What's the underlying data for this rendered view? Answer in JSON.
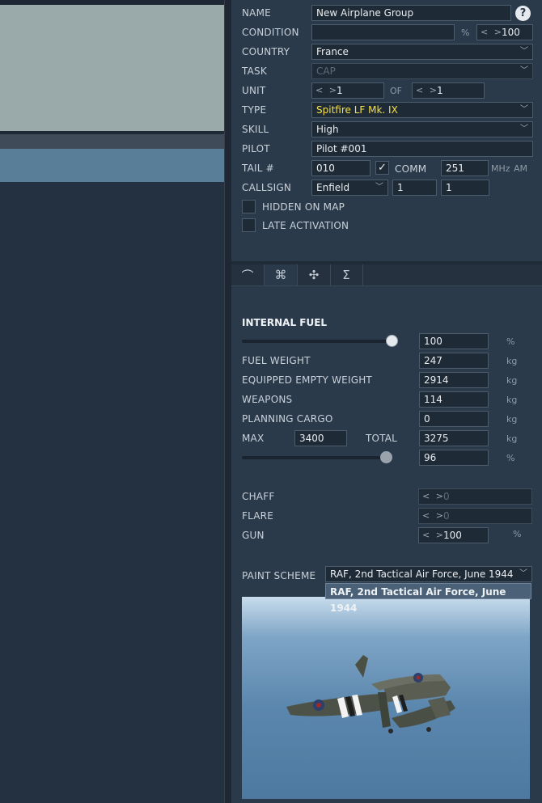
{
  "group": {
    "name_label": "NAME",
    "name_value": "New Airplane Group",
    "help_label": "?",
    "condition_label": "CONDITION",
    "condition_value": "",
    "condition_unit": "%",
    "condition_spin": "< >",
    "condition_pct": "100",
    "country_label": "COUNTRY",
    "country_value": "France",
    "task_label": "TASK",
    "task_value": "CAP",
    "unit_label": "UNIT",
    "unit_spin": "< >",
    "unit_value": "1",
    "of_label": "OF",
    "of_value": "1",
    "type_label": "TYPE",
    "type_value": "Spitfire LF Mk. IX",
    "type_color": "#f5e14a",
    "skill_label": "SKILL",
    "skill_value": "High",
    "pilot_label": "PILOT",
    "pilot_value": "Pilot #001",
    "tail_label": "TAIL #",
    "tail_value": "010",
    "comm_check": "✓",
    "comm_label": "COMM",
    "comm_value": "251",
    "mhz_label": "MHz",
    "am_label": "AM",
    "callsign_label": "CALLSIGN",
    "callsign_value": "Enfield",
    "callsign_num1": "1",
    "callsign_num2": "1",
    "hidden_label": "HIDDEN ON MAP",
    "late_label": "LATE ACTIVATION"
  },
  "tabs": [
    {
      "icon": "route-icon",
      "glyph": "⌒"
    },
    {
      "icon": "payload-icon",
      "glyph": "⌘"
    },
    {
      "icon": "drone-icon",
      "glyph": "✣"
    },
    {
      "icon": "summary-icon",
      "glyph": "Σ"
    }
  ],
  "fuel": {
    "header": "INTERNAL FUEL",
    "pct_value": "100",
    "pct_unit": "%",
    "fuel_weight_label": "FUEL WEIGHT",
    "fuel_weight_value": "247",
    "empty_weight_label": "EQUIPPED EMPTY WEIGHT",
    "empty_weight_value": "2914",
    "weapons_label": "WEAPONS",
    "weapons_value": "114",
    "cargo_label": "PLANNING CARGO",
    "cargo_value": "0",
    "max_label": "MAX",
    "max_value": "3400",
    "total_label": "TOTAL",
    "total_value": "3275",
    "total_pct_value": "96",
    "kg": "kg",
    "fuel_fraction": 1.0,
    "total_fraction": 0.96
  },
  "counter": {
    "chaff_label": "CHAFF",
    "chaff_value": "0",
    "flare_label": "FLARE",
    "flare_value": "0",
    "gun_label": "GUN",
    "gun_value": "100",
    "gun_unit": "%",
    "spin": "< >"
  },
  "paint": {
    "label": "PAINT SCHEME",
    "value": "RAF, 2nd Tactical Air Force, June 1944",
    "dropdown_option": "RAF, 2nd Tactical Air Force, June 1944"
  },
  "colors": {
    "panel": "#2b3a4b",
    "selection": "#587f97"
  }
}
